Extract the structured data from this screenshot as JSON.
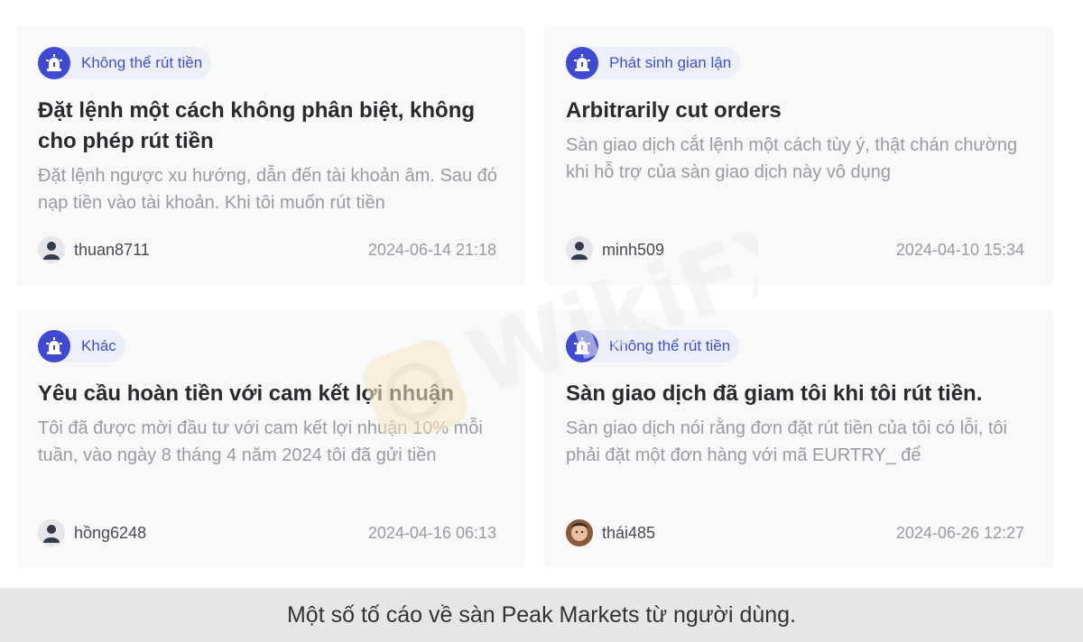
{
  "colors": {
    "accent": "#3d4ad1",
    "tag_bg": "#edeff8",
    "card_bg": "#f8f8f9",
    "caption_bg": "#e6e6e6"
  },
  "cards": [
    {
      "tag": "Không thể rút tiền",
      "tag_icon": "alarm-siren-icon",
      "title": "Đặt lệnh một cách không phân biệt, không cho phép rút tiền",
      "excerpt": "Đặt lệnh ngược xu hướng, dẫn đến tài khoản âm. Sau đó nạp tiền vào tài khoản. Khi tôi muốn rút tiền",
      "username": "thuan8711",
      "avatar": "default-user-icon",
      "date": "2024-06-14 21:18"
    },
    {
      "tag": "Phát sinh gian lận",
      "tag_icon": "alarm-siren-icon",
      "title": "Arbitrarily cut orders",
      "excerpt": "Sàn giao dịch cắt lệnh một cách tùy ý, thật chán chường khi hỗ trợ của sàn giao dịch này vô dụng",
      "username": "minh509",
      "avatar": "default-user-icon",
      "date": "2024-04-10 15:34"
    },
    {
      "tag": "Khác",
      "tag_icon": "alarm-siren-icon",
      "title": "Yêu cầu hoàn tiền với cam kết lợi nhuận",
      "excerpt": "Tôi đã được mời đầu tư với cam kết lợi nhuận 10% mỗi tuần, vào ngày 8 tháng 4 năm 2024 tôi đã gửi tiền",
      "username": "hồng6248",
      "avatar": "default-user-icon",
      "date": "2024-04-16 06:13"
    },
    {
      "tag": "Không thể rút tiền",
      "tag_icon": "alarm-siren-icon",
      "title": "Sàn giao dịch đã giam tôi khi tôi rút tiền.",
      "excerpt": "Sàn giao dịch nói rằng đơn đặt rút tiền của tôi có lỗi, tôi phải đặt một đơn hàng với mã EURTRY_ để",
      "username": "thái485",
      "avatar": "photo-avatar",
      "date": "2024-06-26 12:27"
    }
  ],
  "caption": "Một số tố cáo về sàn Peak Markets từ người dùng.",
  "watermark": "WikiFX"
}
